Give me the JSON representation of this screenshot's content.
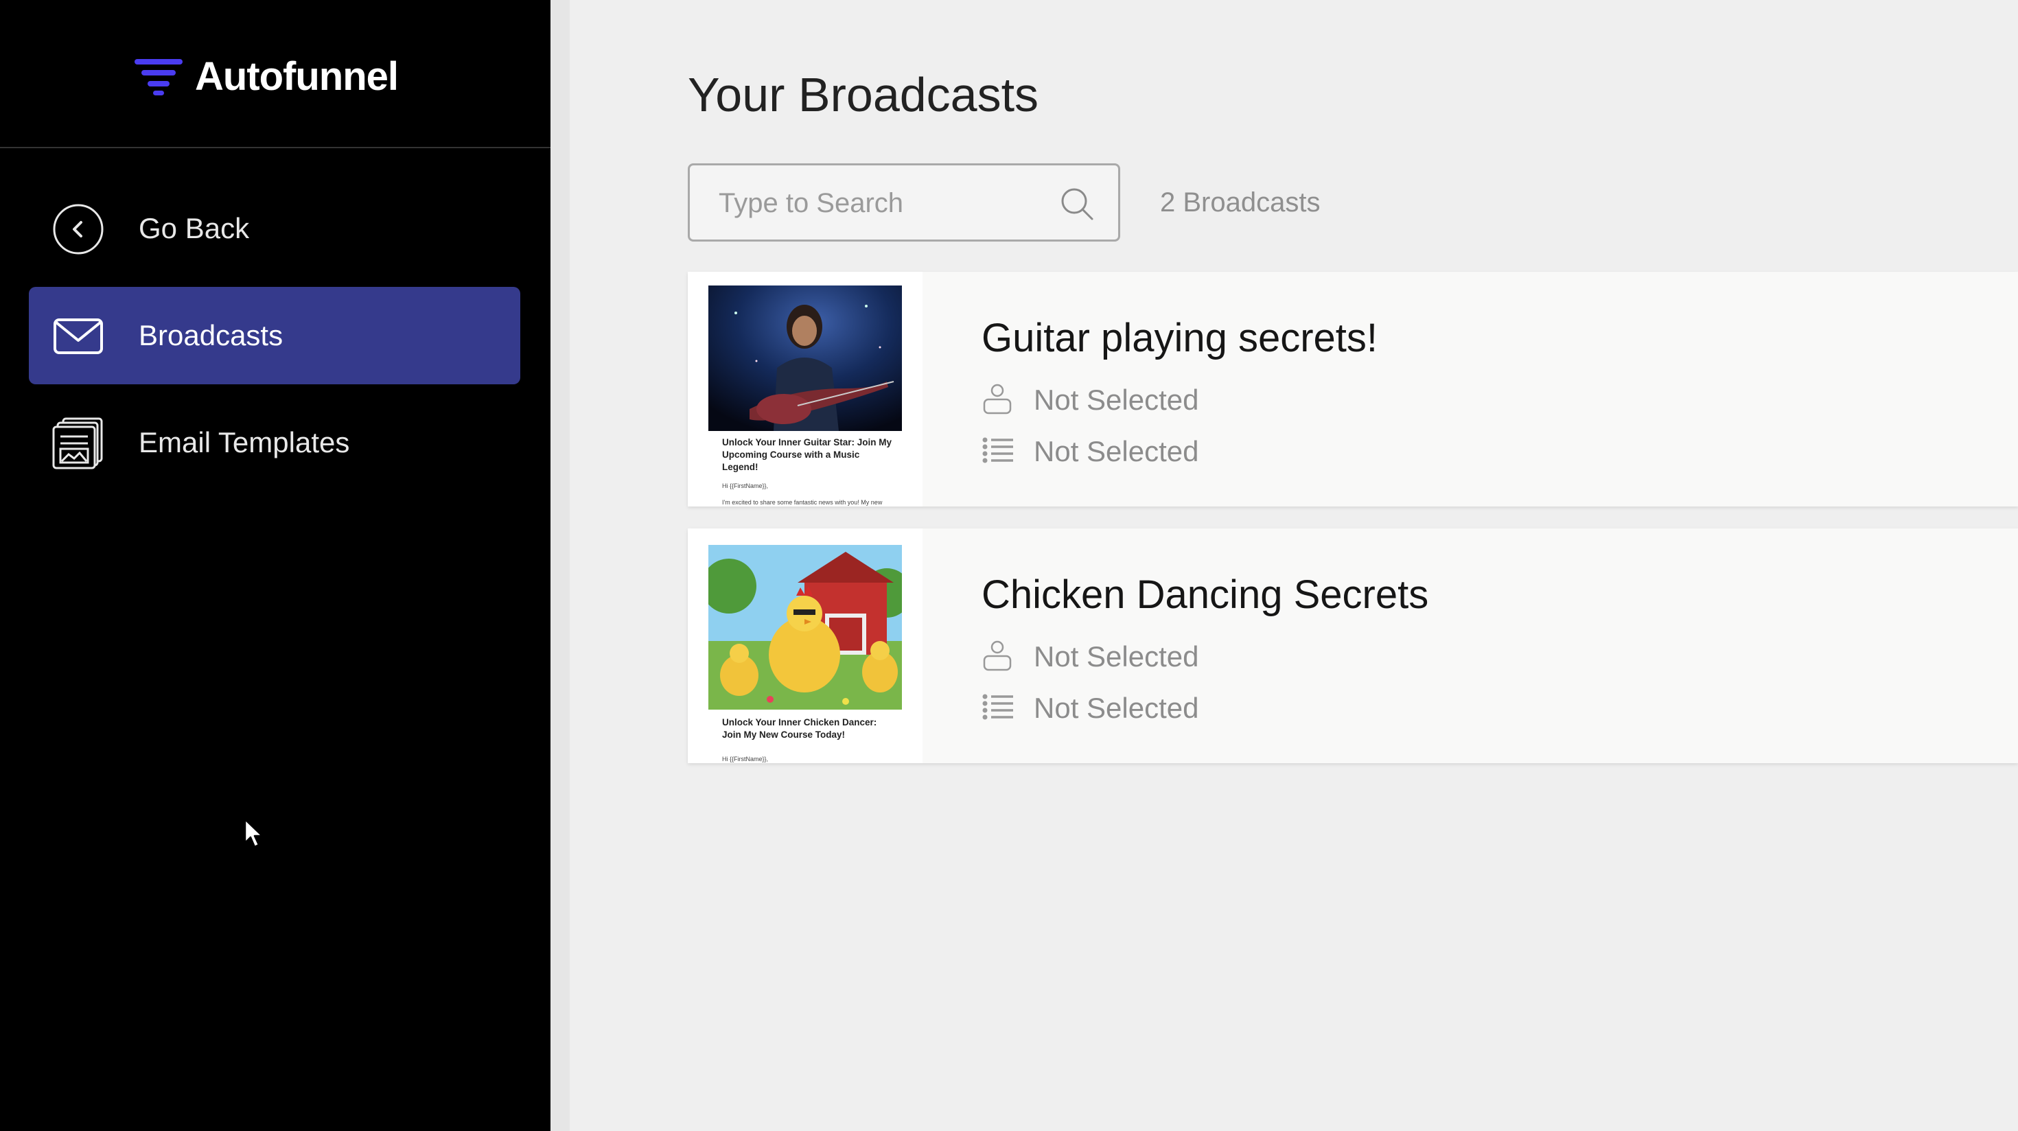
{
  "app": {
    "name": "Autofunnel"
  },
  "sidebar": {
    "items": [
      {
        "label": "Go Back",
        "icon": "chevron-left-circle-icon"
      },
      {
        "label": "Broadcasts",
        "icon": "envelope-icon",
        "active": true
      },
      {
        "label": "Email Templates",
        "icon": "email-templates-icon"
      }
    ]
  },
  "main": {
    "title": "Your Broadcasts",
    "search": {
      "placeholder": "Type to Search",
      "value": ""
    },
    "count_label": "2 Broadcasts",
    "broadcasts": [
      {
        "title": "Guitar playing secrets!",
        "audience": "Not Selected",
        "list": "Not Selected",
        "thumbnail": {
          "image": "guitarist-image",
          "heading": "Unlock Your Inner Guitar Star: Join My Upcoming Course with a Music Legend!",
          "greeting": "Hi {{FirstName}},",
          "body": "I'm excited to share some fantastic news with you! My new"
        }
      },
      {
        "title": "Chicken Dancing Secrets",
        "audience": "Not Selected",
        "list": "Not Selected",
        "thumbnail": {
          "image": "dancing-chickens-image",
          "heading": "Unlock Your Inner Chicken Dancer: Join My New Course Today!",
          "greeting": "Hi {{FirstName}},"
        }
      }
    ]
  },
  "colors": {
    "sidebar_bg": "#000000",
    "active_nav": "#353a8c",
    "brand_icon": "#4a3cf0",
    "page_bg": "#efefef"
  }
}
